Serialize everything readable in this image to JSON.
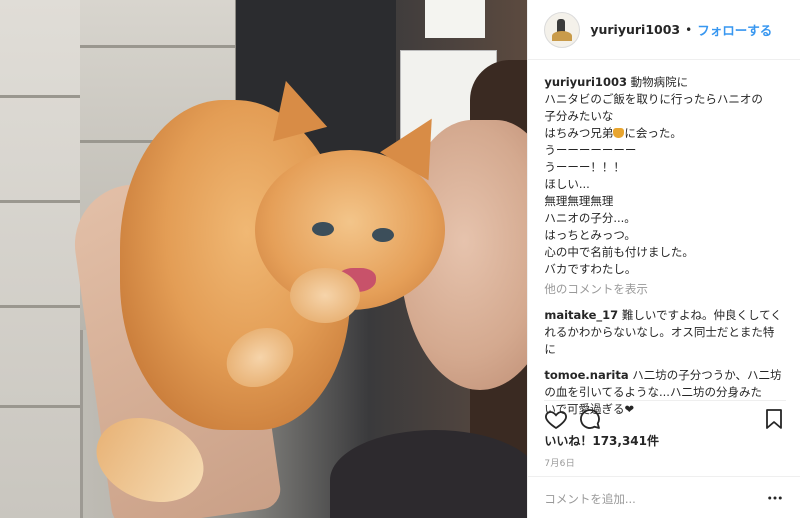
{
  "post": {
    "username": "yuriyuri1003",
    "follow_label": "フォローする",
    "separator": "•",
    "caption_lines": [
      "動物病院に",
      "ハニタビのご飯を取りに行ったらハニオの",
      "子分みたいな",
      "はちみつ兄弟",
      "に会った。",
      "うーーーーーーー",
      "うーーー！！！",
      "ほしい...",
      "無理無理無理",
      "ハニオの子分...。",
      "はっちとみっつ。",
      "心の中で名前も付けました。",
      "バカですわたし。"
    ],
    "view_more_comments": "他のコメントを表示",
    "comments": [
      {
        "user": "maitake_17",
        "text_lines": [
          "難しいですよね。仲良くしてく",
          "れるかわからないなし。オス同士だとまた特",
          "に"
        ]
      },
      {
        "user": "tomoe.narita",
        "text_lines": [
          "ハ二坊の子分つうか、ハ二坊",
          "の血を引いてるような...ハ二坊の分身みた",
          "いで可愛過ぎる❤"
        ]
      }
    ],
    "likes_label": "いいね！173,341件",
    "date": "7月6日",
    "add_comment_placeholder": "コメントを追加...",
    "icons": [
      "heart-icon",
      "comment-icon",
      "bookmark-icon",
      "more-icon"
    ]
  }
}
